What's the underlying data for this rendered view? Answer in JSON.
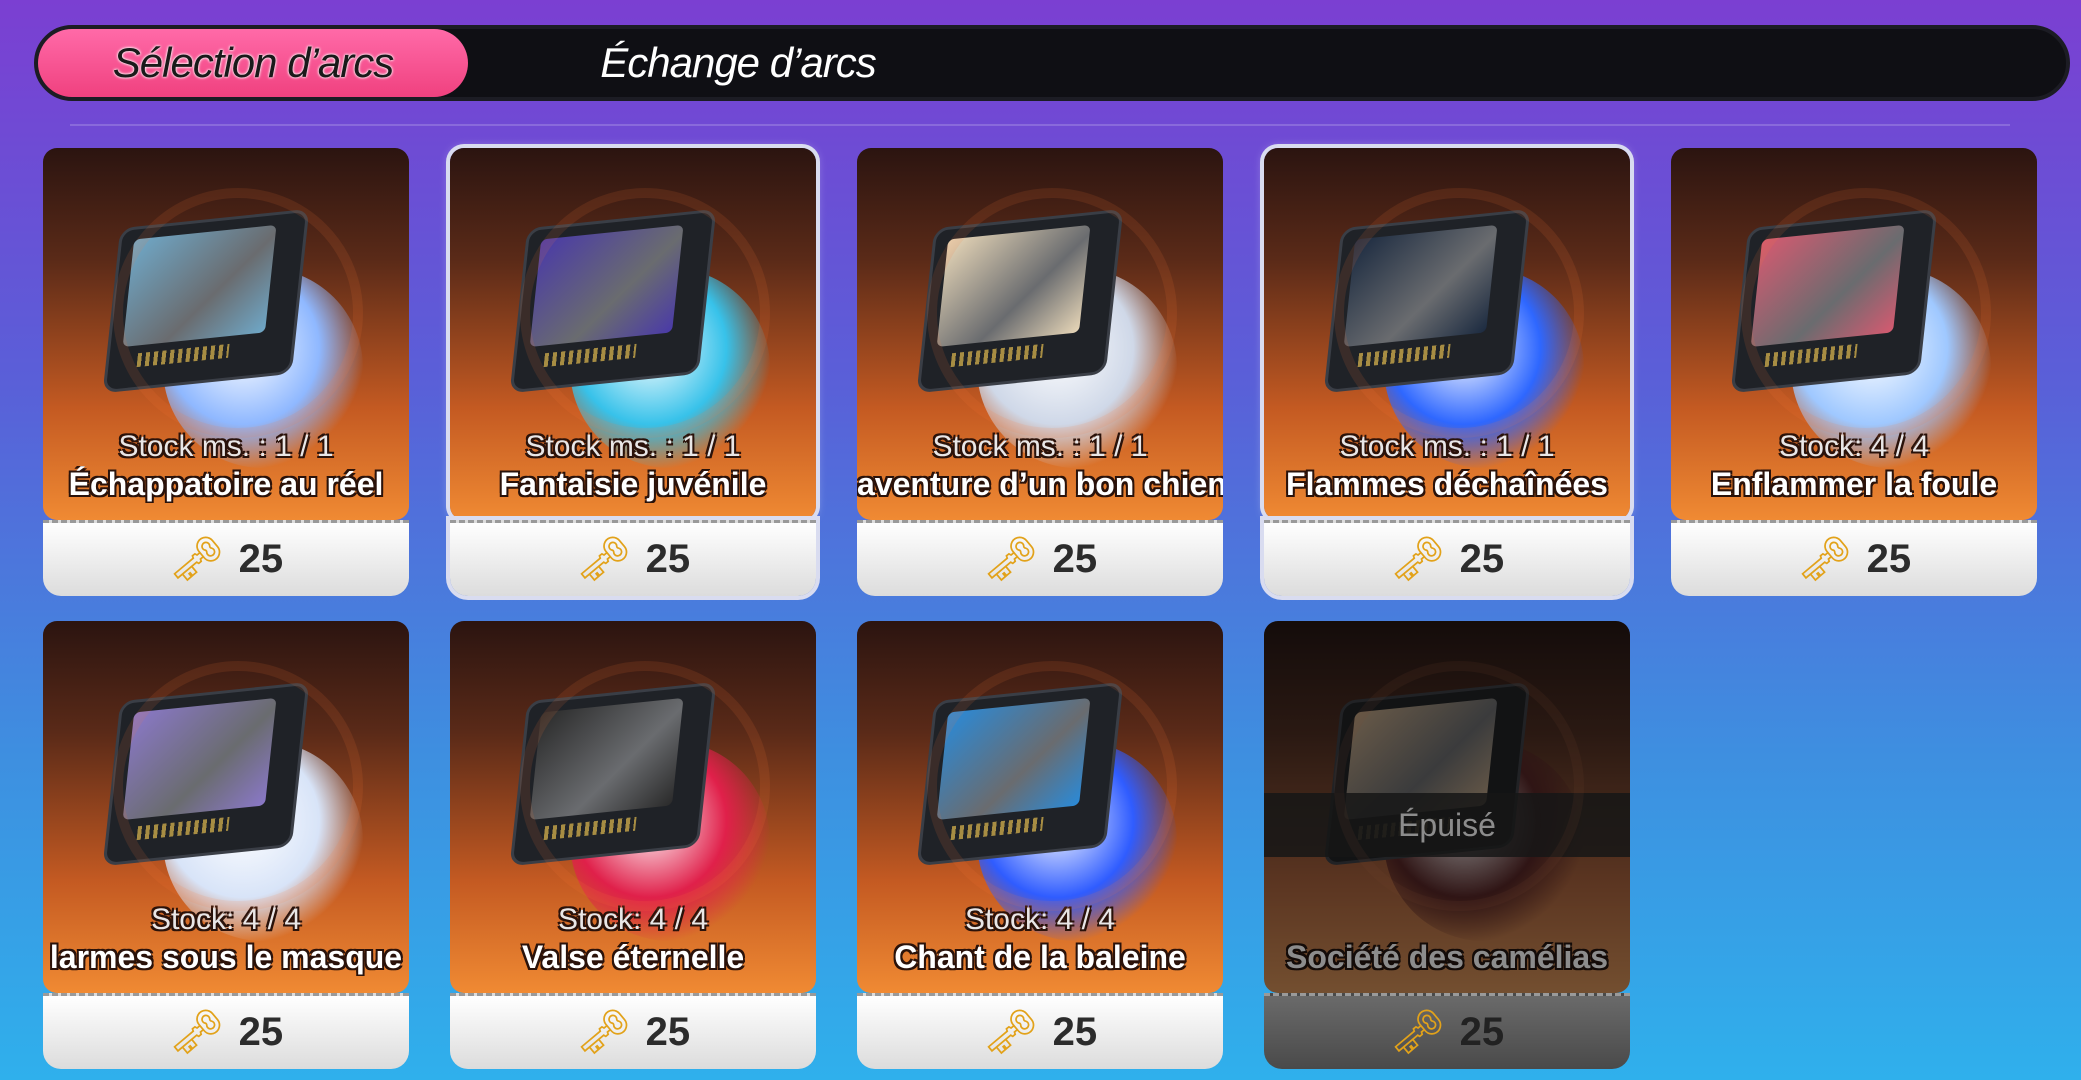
{
  "tabs": [
    {
      "label": "Sélection d’arcs"
    },
    {
      "label": "Échange d’arcs"
    }
  ],
  "cards": [
    {
      "stock": "Stock ms. :  1 / 1",
      "title": "Échappatoire au réel",
      "price": "25",
      "screen": "#6fa8c8",
      "disc": "#8fb8ff",
      "status": "available"
    },
    {
      "stock": "Stock ms. :  1 / 1",
      "title": "Fantaisie juvénile",
      "price": "25",
      "screen": "#4a3aa8",
      "disc": "#37c2ea",
      "status": "selected"
    },
    {
      "stock": "Stock ms. :  1 / 1",
      "title": "aventure d’un bon chien",
      "price": "25",
      "screen": "#e8d7b8",
      "disc": "#cfd8e8",
      "status": "available"
    },
    {
      "stock": "Stock ms. :  1 / 1",
      "title": "Flammes déchaînées",
      "price": "25",
      "screen": "#1b2a40",
      "disc": "#2e67ff",
      "status": "selected"
    },
    {
      "stock": "Stock:  4 / 4",
      "title": "Enflammer la foule",
      "price": "25",
      "screen": "#d55a70",
      "disc": "#9fc8ff",
      "status": "available"
    },
    {
      "stock": "Stock:  4 / 4",
      "title": "larmes sous le masque",
      "price": "25",
      "screen": "#8a78c8",
      "disc": "#d8e4f8",
      "status": "available"
    },
    {
      "stock": "Stock:  4 / 4",
      "title": "Valse éternelle",
      "price": "25",
      "screen": "#2a2a2a",
      "disc": "#e0204a",
      "status": "available"
    },
    {
      "stock": "Stock:  4 / 4",
      "title": "Chant de la baleine",
      "price": "25",
      "screen": "#2a8ad8",
      "disc": "#2f5cff",
      "status": "available"
    },
    {
      "stock": "",
      "title": "Société des camélias",
      "price": "25",
      "screen": "#c8a070",
      "disc": "#6a2020",
      "status": "soldout",
      "sold_label": "Épuisé"
    }
  ],
  "colors": {
    "tab_active": "#f0417f",
    "key": "#e2a21a"
  },
  "icons": {
    "price": "key-icon"
  }
}
